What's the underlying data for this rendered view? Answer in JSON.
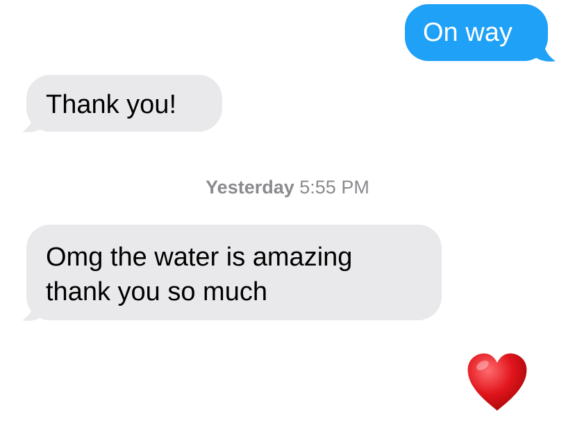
{
  "conversation": {
    "messages": [
      {
        "direction": "outgoing",
        "text": "On way"
      },
      {
        "direction": "incoming",
        "text": "Thank you!"
      },
      {
        "direction": "incoming",
        "lines": [
          "Omg the water is amazing",
          "thank you so much"
        ]
      }
    ],
    "timestamp": {
      "day": "Yesterday",
      "time": "5:55 PM"
    },
    "reaction_icon": "red-heart-icon"
  },
  "colors": {
    "outgoing_bubble": "#1fa1f7",
    "incoming_bubble": "#e9e9eb",
    "timestamp_text": "#8a8a8e",
    "heart": "#e0151b"
  }
}
